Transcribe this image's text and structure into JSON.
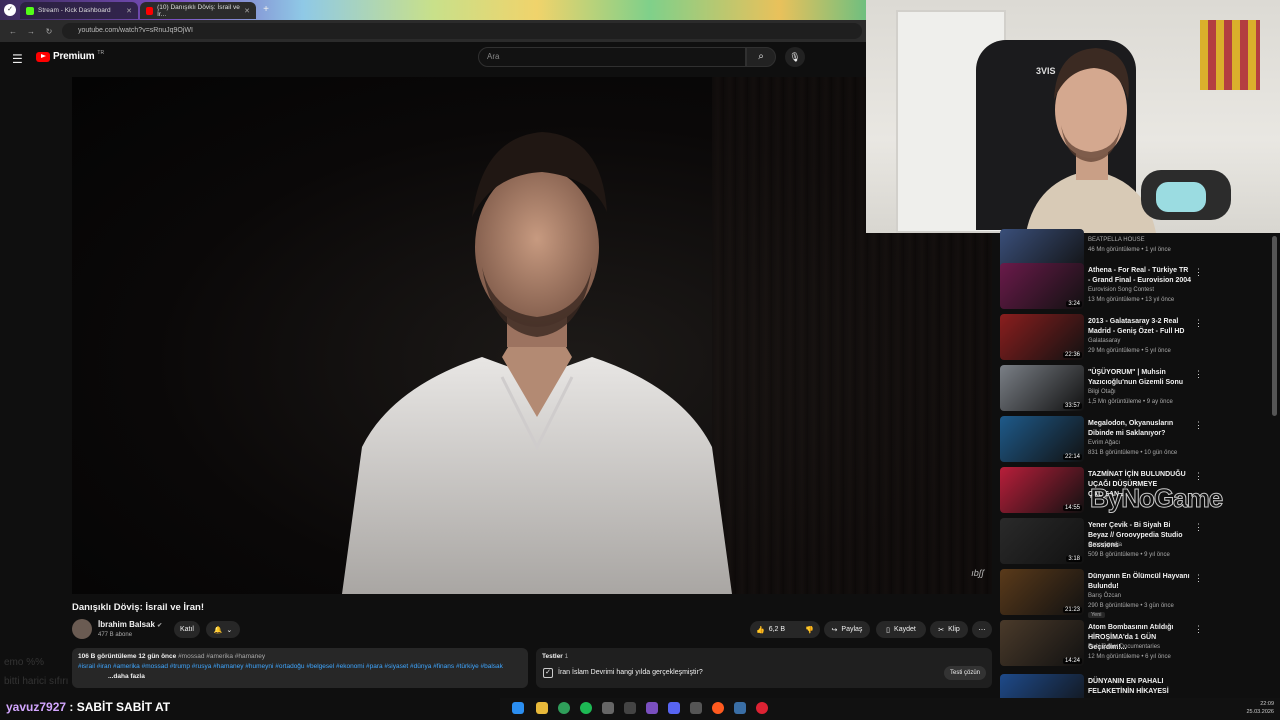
{
  "browser": {
    "tabs": [
      {
        "label": "Stream - Kick Dashboard",
        "accent": "#53fc18"
      },
      {
        "label": "(10) Danışıklı Döviş: İsrail ve İr...",
        "accent": "#ff0000"
      }
    ],
    "url": "youtube.com/watch?v=sRnuJq9OjWI"
  },
  "header": {
    "brand": "Premium",
    "brand_country": "TR",
    "search_placeholder": "Ara"
  },
  "video": {
    "title": "Danışıklı Döviş: İsrail ve İran!",
    "channel": "İbrahim Balsak",
    "subscribers": "477 B abone",
    "join_label": "Katıl",
    "likes": "6,2 B",
    "share_label": "Paylaş",
    "save_label": "Kaydet",
    "clip_label": "Klip",
    "watermark": "ıbʃʃ"
  },
  "description": {
    "stats": "106 B görüntüleme  12 gün önce",
    "hashtags_inline": "#mossad #amerika #hamaney",
    "tags": "#israil #iran #amerika #mossad #trump #rusya #hamaney #humeyni #ortadoğu #belgesel #ekonomi #para #siyaset #dünya #finans #türkiye #balsak",
    "more": "...daha fazla"
  },
  "quiz": {
    "heading": "Testler",
    "count": "1",
    "question": "İran İslam Devrimi hangi yılda gerçekleşmiştir?",
    "action": "Testi çözün"
  },
  "recommendations": [
    {
      "title": "",
      "channel": "BEATPELLA HOUSE",
      "meta": "46 Mn görüntüleme • 1 yıl önce",
      "duration": "2:49",
      "thumb": "#3a4f7a"
    },
    {
      "title": "Athena - For Real - Türkiye TR - Grand Final - Eurovision 2004",
      "channel": "Eurovision Song Contest",
      "meta": "13 Mn görüntüleme • 13 yıl önce",
      "duration": "3:24",
      "thumb": "#6a1a4a"
    },
    {
      "title": "2013 - Galatasaray 3-2 Real Madrid - Geniş Özet - Full HD",
      "channel": "Galatasaray",
      "meta": "29 Mn görüntüleme • 5 yıl önce",
      "duration": "22:36",
      "thumb": "#8a1e1e"
    },
    {
      "title": "\"ÜŞÜYORUM\" | Muhsin Yazıcıoğlu'nun Gizemli Sonu",
      "channel": "Bilgi Otağı",
      "meta": "1,5 Mn görüntüleme • 9 ay önce",
      "duration": "33:57",
      "thumb": "#7a7f86"
    },
    {
      "title": "Megalodon, Okyanusların Dibinde mi Saklanıyor?",
      "channel": "Evrim Ağacı",
      "meta": "831 B görüntüleme • 10 gün önce",
      "duration": "22:14",
      "thumb": "#1e5a8a"
    },
    {
      "title": "TAZMİNAT İÇİN BULUNDUĞU UÇAĞI DÜŞÜRMEYE ÇALIŞAN...",
      "channel": "",
      "meta": "",
      "duration": "14:55",
      "thumb": "#b81e3a"
    },
    {
      "title": "Yener Çevik - Bi Siyah Bi Beyaz // Groovypedia Studio Sessions",
      "channel": "Groovypedia",
      "meta": "509 B görüntüleme • 9 yıl önce",
      "duration": "3:18",
      "thumb": "#2a2a2a"
    },
    {
      "title": "Dünyanın En Ölümcül Hayvanı Bulundu!",
      "channel": "Barış Özcan",
      "meta": "290 B görüntüleme • 3 gün önce",
      "badge": "Yeni",
      "duration": "21:23",
      "thumb": "#5a3a1a"
    },
    {
      "title": "Atom Bombasının Atıldığı HİROŞİMA'da 1 GÜN Geçirdim!...",
      "channel": "Ruhi Çenet Documentaries",
      "meta": "12 Mn görüntüleme • 6 yıl önce",
      "duration": "14:24",
      "thumb": "#4a3a2a"
    },
    {
      "title": "DÜNYANIN EN PAHALI FELAKETİNİN HİKAYESİ",
      "channel": "",
      "meta": "",
      "duration": "",
      "thumb": "#1e4a8a"
    }
  ],
  "overlay": {
    "stream_brand": "ByNoGame",
    "cam_text": "3VIS",
    "chat_user": "yavuz7927",
    "chat_message": ": SABİT SABİT AT",
    "ghost_line_1": "emo %%",
    "ghost_line_2": "bitti harici sıfırı"
  },
  "tray": {
    "time": "22:09",
    "date": "25.03.2026"
  }
}
